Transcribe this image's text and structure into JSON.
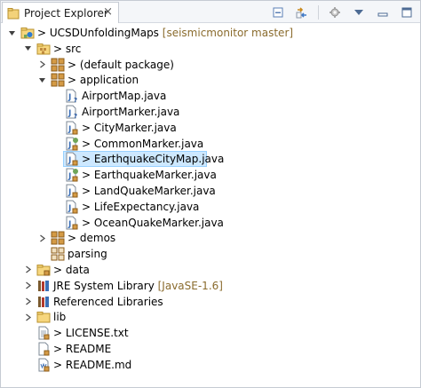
{
  "view": {
    "tab_title": "Project Explorer",
    "close_glyph": "×"
  },
  "toolbar": {
    "buttons": [
      "collapse-all-icon",
      "link-with-editor-icon",
      "filters-icon",
      "view-menu-icon",
      "minimize-icon",
      "maximize-icon"
    ]
  },
  "tree": {
    "project": {
      "prefix": "> ",
      "name": "UCSDUnfoldingMaps",
      "decoration": "[seismicmonitor master]"
    },
    "src": {
      "prefix": "> ",
      "name": "src"
    },
    "default_package": {
      "prefix": "> ",
      "name": "(default package)"
    },
    "application": {
      "prefix": "> ",
      "name": "application"
    },
    "files": [
      {
        "prefix": "",
        "name": "AirportMap.java",
        "icon": "java-file-question-icon"
      },
      {
        "prefix": "",
        "name": "AirportMarker.java",
        "icon": "java-file-question-icon"
      },
      {
        "prefix": "> ",
        "name": "CityMarker.java",
        "icon": "java-file-icon"
      },
      {
        "prefix": "> ",
        "name": "CommonMarker.java",
        "icon": "java-file-abstract-icon"
      },
      {
        "prefix": "> ",
        "name": "EarthquakeCityMap.java",
        "icon": "java-file-icon",
        "selected": true
      },
      {
        "prefix": "> ",
        "name": "EarthquakeMarker.java",
        "icon": "java-file-abstract-icon"
      },
      {
        "prefix": "> ",
        "name": "LandQuakeMarker.java",
        "icon": "java-file-icon"
      },
      {
        "prefix": "> ",
        "name": "LifeExpectancy.java",
        "icon": "java-file-icon"
      },
      {
        "prefix": "> ",
        "name": "OceanQuakeMarker.java",
        "icon": "java-file-icon"
      }
    ],
    "demos": {
      "prefix": "> ",
      "name": "demos"
    },
    "parsing": {
      "prefix": "",
      "name": "parsing"
    },
    "data": {
      "prefix": "> ",
      "name": "data"
    },
    "jre": {
      "prefix": "",
      "name": "JRE System Library",
      "decoration": "[JavaSE-1.6]"
    },
    "referenced": {
      "prefix": "",
      "name": "Referenced Libraries"
    },
    "lib": {
      "prefix": "",
      "name": "lib"
    },
    "license": {
      "prefix": "> ",
      "name": "LICENSE.txt"
    },
    "readme": {
      "prefix": "> ",
      "name": "README"
    },
    "readme_md": {
      "prefix": "> ",
      "name": "README.md"
    }
  },
  "colors": {
    "selection": "#cde8ff",
    "decoration": "#8a6b2d",
    "package_brown": "#c08a3e",
    "java_blue": "#3b6fb6"
  }
}
